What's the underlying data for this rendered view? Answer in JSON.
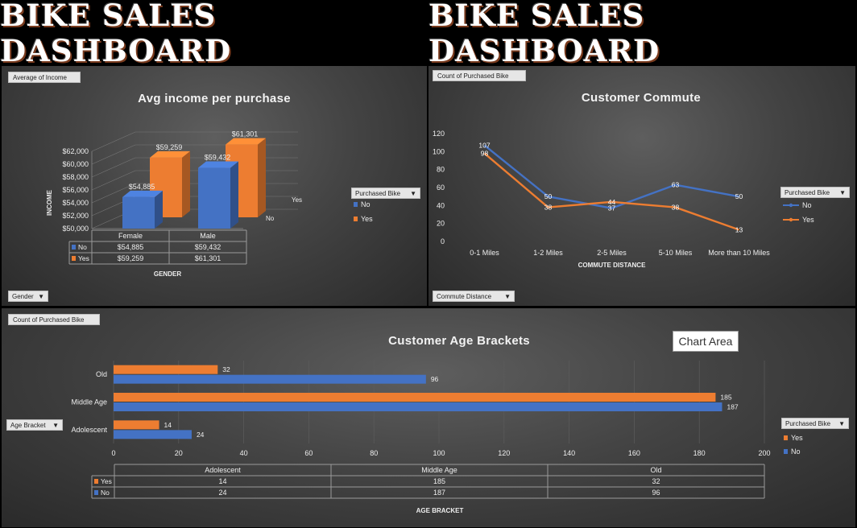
{
  "banner": {
    "title_left": "BIKE SALES DASHBOARD",
    "title_right": "BIKE SALES DASHBOARD"
  },
  "colors": {
    "no": "#4472c4",
    "yes": "#ed7d31"
  },
  "income_panel": {
    "field_chip": "Average of Income",
    "filter_dropdown": "Gender",
    "legend_dropdown": "Purchased Bike",
    "legend": [
      {
        "label": "No"
      },
      {
        "label": "Yes"
      }
    ],
    "table_rows": [
      {
        "label": "No",
        "values": [
          "$54,885",
          "$59,432"
        ]
      },
      {
        "label": "Yes",
        "values": [
          "$59,259",
          "$61,301"
        ]
      }
    ],
    "depth_labels": [
      "Yes",
      "No"
    ]
  },
  "commute_panel": {
    "field_chip": "Count of Purchased Bike",
    "filter_dropdown": "Commute Distance",
    "legend_dropdown": "Purchased Bike",
    "legend": [
      {
        "label": "No"
      },
      {
        "label": "Yes"
      }
    ]
  },
  "age_panel": {
    "field_chip": "Count of Purchased Bike",
    "filter_dropdown": "Age Bracket",
    "legend_dropdown": "Purchased Bike",
    "legend": [
      {
        "label": "Yes"
      },
      {
        "label": "No"
      }
    ],
    "tooltip": "Chart Area",
    "table_rows": [
      {
        "label": "Yes",
        "values": [
          "14",
          "185",
          "32"
        ]
      },
      {
        "label": "No",
        "values": [
          "24",
          "187",
          "96"
        ]
      }
    ]
  },
  "chart_data": [
    {
      "type": "bar",
      "title": "Avg income per purchase",
      "xlabel": "GENDER",
      "ylabel": "INCOME",
      "categories": [
        "Female",
        "Male"
      ],
      "series": [
        {
          "name": "No",
          "values": [
            54885,
            59432
          ],
          "labels": [
            "$54,885",
            "$59,432"
          ]
        },
        {
          "name": "Yes",
          "values": [
            59259,
            61301
          ],
          "labels": [
            "$59,259",
            "$61,301"
          ]
        }
      ],
      "ylim": [
        50000,
        62000
      ],
      "yticks": [
        "$50,000",
        "$52,000",
        "$54,000",
        "$56,000",
        "$58,000",
        "$60,000",
        "$62,000"
      ],
      "grid": true,
      "legend": "right"
    },
    {
      "type": "line",
      "title": "Customer Commute",
      "xlabel": "COMMUTE DISTANCE",
      "ylabel": "",
      "categories": [
        "0-1 Miles",
        "1-2 Miles",
        "2-5 Miles",
        "5-10 Miles",
        "More than 10 Miles"
      ],
      "series": [
        {
          "name": "No",
          "values": [
            107,
            50,
            37,
            63,
            50
          ]
        },
        {
          "name": "Yes",
          "values": [
            98,
            38,
            44,
            38,
            13
          ]
        }
      ],
      "ylim": [
        0,
        120
      ],
      "yticks": [
        0,
        20,
        40,
        60,
        80,
        100,
        120
      ],
      "grid": false,
      "legend": "right"
    },
    {
      "type": "bar",
      "orientation": "horizontal",
      "title": "Customer Age Brackets",
      "xlabel": "AGE BRACKET",
      "ylabel": "",
      "categories": [
        "Adolescent",
        "Middle Age",
        "Old"
      ],
      "series": [
        {
          "name": "Yes",
          "values": [
            14,
            185,
            32
          ]
        },
        {
          "name": "No",
          "values": [
            24,
            187,
            96
          ]
        }
      ],
      "xlim": [
        0,
        200
      ],
      "xticks": [
        0,
        20,
        40,
        60,
        80,
        100,
        120,
        140,
        160,
        180,
        200
      ],
      "grid": true,
      "legend": "right"
    }
  ]
}
